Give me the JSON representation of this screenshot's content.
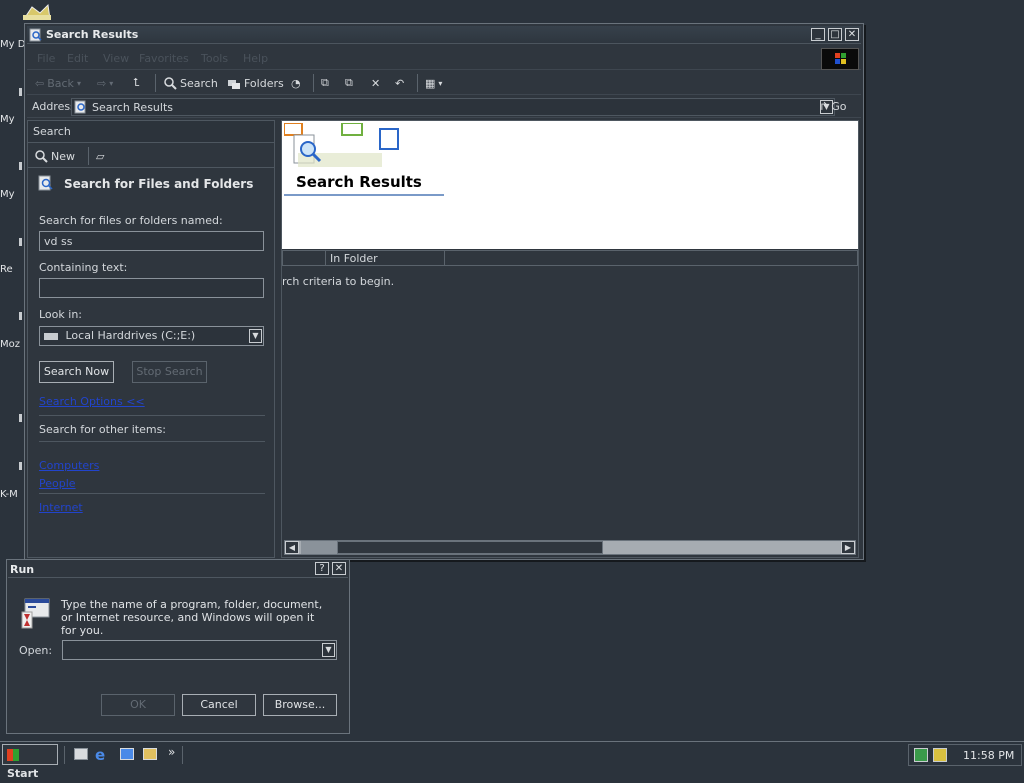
{
  "desktop": {
    "icons": [
      "My D",
      "My",
      "My",
      "Re",
      "Moz",
      "K-M"
    ]
  },
  "explorer": {
    "title": "Search Results",
    "menu": [
      "File",
      "Edit",
      "View",
      "Favorites",
      "Tools",
      "Help"
    ],
    "toolbar": {
      "back": "Back",
      "search": "Search",
      "folders": "Folders"
    },
    "address": {
      "label": "Address",
      "value": "Search Results",
      "go": "Go"
    },
    "search_pane": {
      "header": "Search",
      "new_label": "New",
      "heading": "Search for Files and Folders",
      "named_label": "Search for files or folders named:",
      "named_value": "vd ss",
      "containing_label": "Containing text:",
      "containing_value": "",
      "lookin_label": "Look in:",
      "lookin_value": "Local Harddrives (C:;E:)",
      "search_now": "Search Now",
      "stop_search": "Stop Search",
      "options_link": "Search Options <<",
      "other_label": "Search for other items:",
      "other_links": [
        "Computers",
        "People",
        "Internet"
      ]
    },
    "results": {
      "banner_title": "Search Results",
      "columns": [
        "",
        "In Folder"
      ],
      "message": "rch criteria to begin."
    }
  },
  "run_dialog": {
    "title": "Run",
    "help_btn": "?",
    "close_btn": "X",
    "description": "Type the name of a program, folder, document, or Internet resource, and Windows will open it for you.",
    "open_label": "Open:",
    "open_value": "",
    "ok": "OK",
    "cancel": "Cancel",
    "browse": "Browse..."
  },
  "taskbar": {
    "start": "Start",
    "more": "»",
    "clock": "11:58 PM"
  },
  "colors": {
    "desktop": "#2b333c",
    "window": "#2f363e",
    "link": "#2244cc",
    "banner": "#ffffff"
  }
}
